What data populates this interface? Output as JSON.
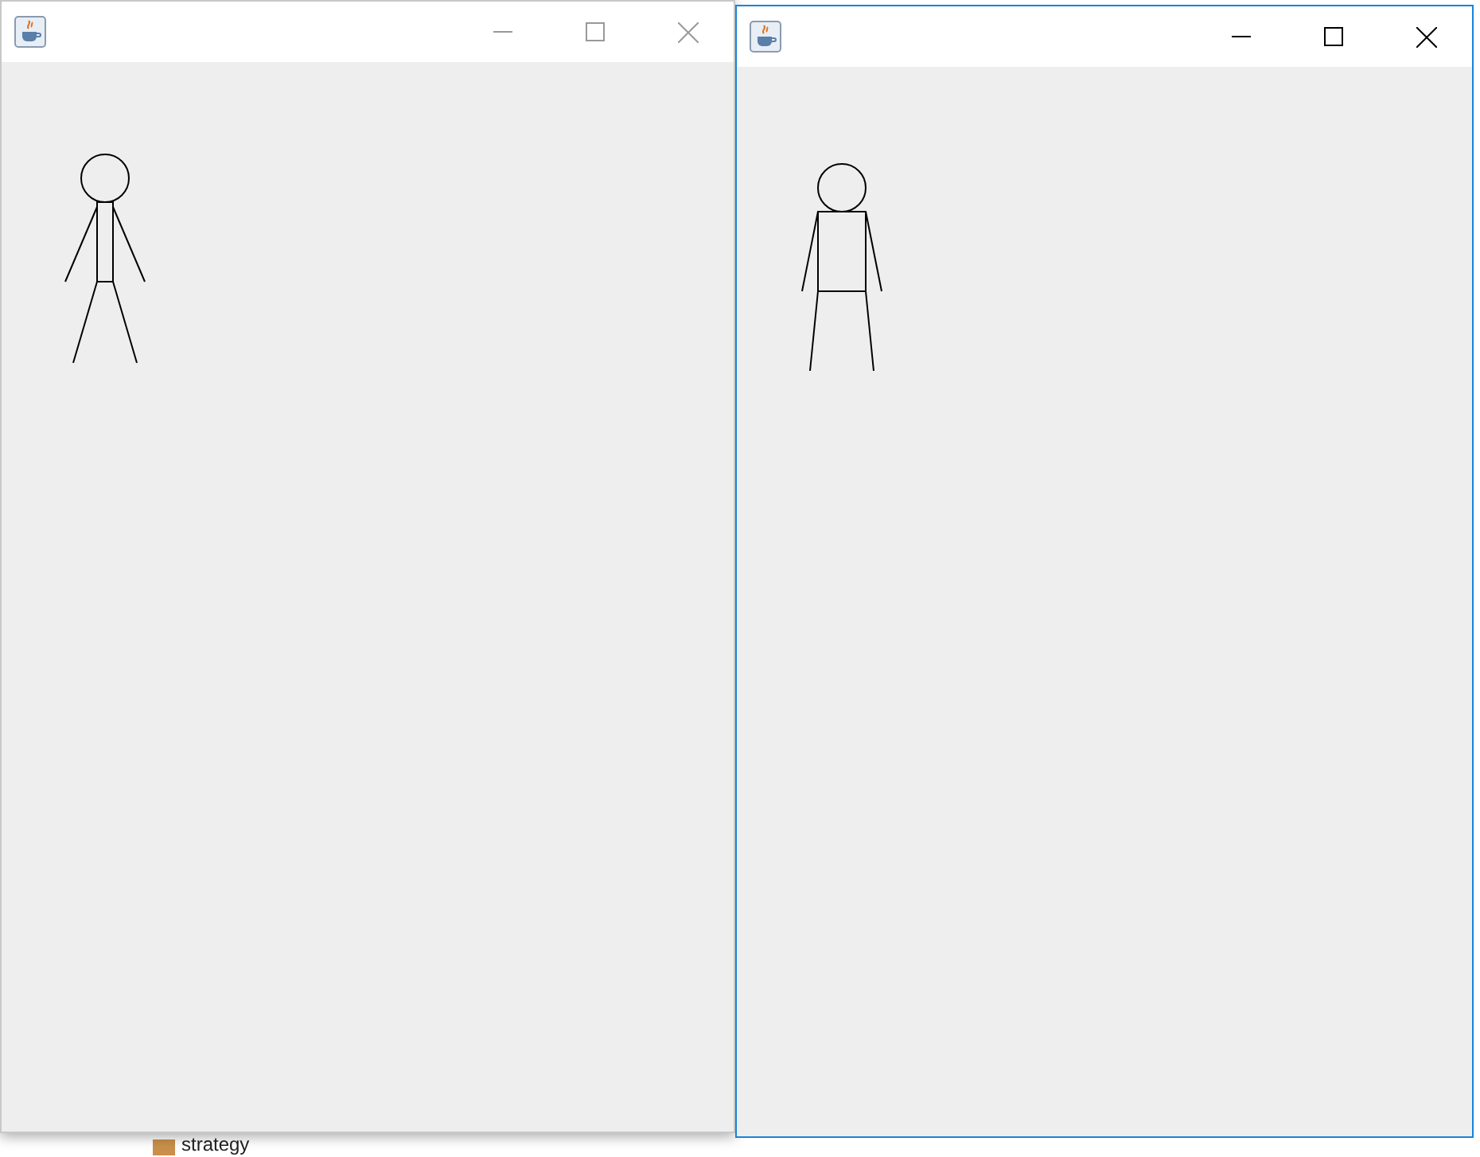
{
  "background": {
    "tree_item": "strategy"
  },
  "windows": [
    {
      "active": false,
      "figure": {
        "kind": "narrow"
      }
    },
    {
      "active": true,
      "figure": {
        "kind": "wide"
      }
    }
  ]
}
